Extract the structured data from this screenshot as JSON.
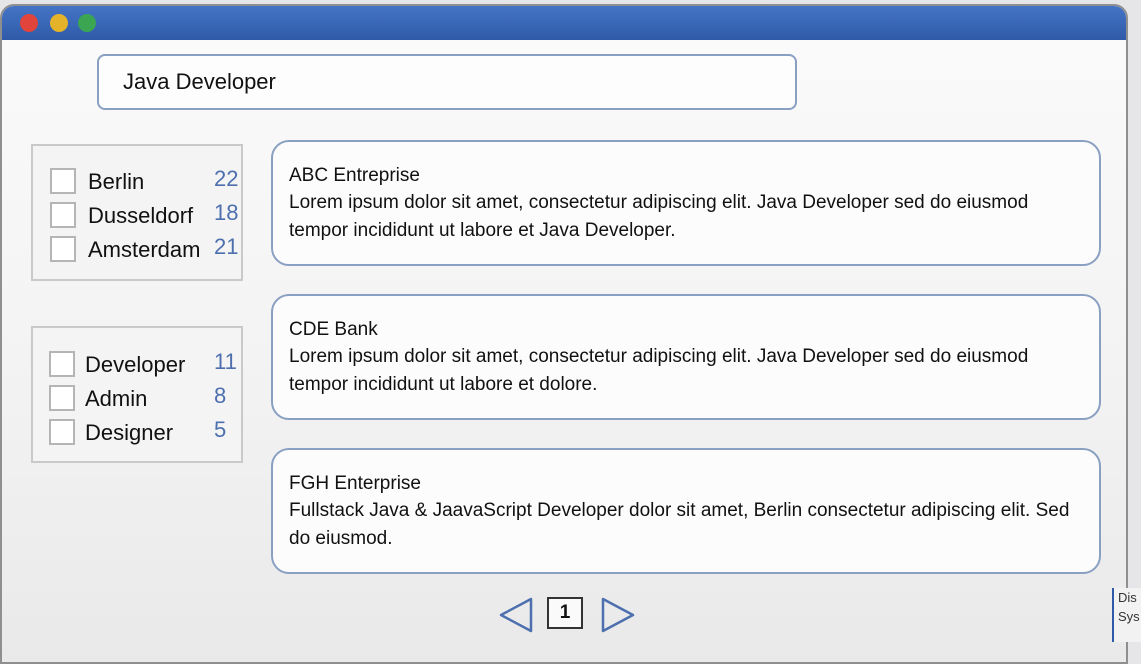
{
  "search": {
    "value": "Java Developer"
  },
  "filters": {
    "locations": [
      {
        "label": "Berlin",
        "count": "22"
      },
      {
        "label": "Dusseldorf",
        "count": "18"
      },
      {
        "label": "Amsterdam",
        "count": "21"
      }
    ],
    "roles": [
      {
        "label": "Developer",
        "count": "11"
      },
      {
        "label": "Admin",
        "count": "8"
      },
      {
        "label": "Designer",
        "count": "5"
      }
    ]
  },
  "results": [
    {
      "company": "ABC Entreprise",
      "description": "Lorem ipsum dolor sit amet, consectetur adipiscing elit. Java Developer sed do eiusmod tempor incididunt ut labore et Java Developer."
    },
    {
      "company": "CDE Bank",
      "description": "Lorem ipsum dolor sit amet, consectetur adipiscing elit. Java Developer sed do eiusmod tempor incididunt ut labore et dolore."
    },
    {
      "company": "FGH Enterprise",
      "description": "Fullstack Java & JaavaScript Developer dolor sit amet, Berlin consectetur adipiscing elit. Sed do eiusmod."
    }
  ],
  "pagination": {
    "current_page": "1"
  },
  "side_fragment": {
    "line1": "Dis",
    "line2": "Sys"
  },
  "colors": {
    "titlebar": "#2f5aa8",
    "count_text": "#4d6fae",
    "card_border": "#8aa0c2",
    "dot_red": "#e0443a",
    "dot_yellow": "#e4b32a",
    "dot_green": "#3aa652"
  },
  "icons": {
    "window_controls": [
      "close-dot-icon",
      "minimize-dot-icon",
      "maximize-dot-icon"
    ],
    "pagination": [
      "prev-arrow-icon",
      "next-arrow-icon"
    ]
  }
}
